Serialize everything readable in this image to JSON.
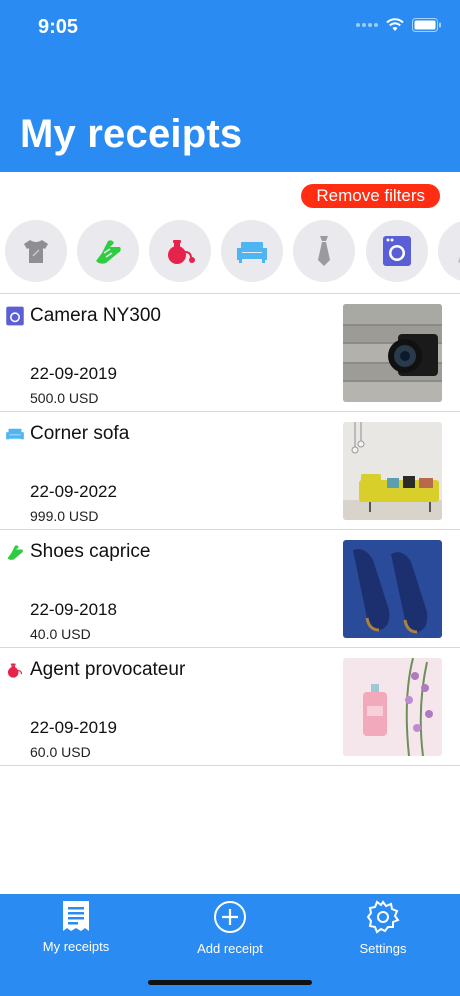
{
  "status_bar": {
    "time": "9:05"
  },
  "header": {
    "title": "My receipts"
  },
  "filters": {
    "remove_label": "Remove filters"
  },
  "categories": [
    {
      "icon": "tshirt-icon",
      "color": "#8e8e93"
    },
    {
      "icon": "sneaker-icon",
      "color": "#2ecc40"
    },
    {
      "icon": "perfume-icon",
      "color": "#e5234b"
    },
    {
      "icon": "sofa-icon",
      "color": "#4fb4f2"
    },
    {
      "icon": "tie-icon",
      "color": "#9a9a9f"
    },
    {
      "icon": "washing-machine-icon",
      "color": "#5b5fd6"
    },
    {
      "icon": "partial-icon",
      "color": "#b0b0b5"
    }
  ],
  "receipts": [
    {
      "title": "Camera NY300",
      "date": "22-09-2019",
      "price": "500.0 USD",
      "icon": "washing-machine-icon"
    },
    {
      "title": "Corner sofa",
      "date": "22-09-2022",
      "price": "999.0 USD",
      "icon": "sofa-icon"
    },
    {
      "title": "Shoes caprice",
      "date": "22-09-2018",
      "price": "40.0 USD",
      "icon": "sneaker-icon"
    },
    {
      "title": "Agent provocateur",
      "date": "22-09-2019",
      "price": "60.0 USD",
      "icon": "perfume-icon"
    }
  ],
  "tabbar": {
    "items": [
      {
        "label": "My receipts",
        "icon": "receipt-icon"
      },
      {
        "label": "Add receipt",
        "icon": "plus-circle-icon"
      },
      {
        "label": "Settings",
        "icon": "gear-icon"
      }
    ]
  },
  "colors": {
    "primary": "#2a8cf2",
    "danger": "#ff2d12"
  }
}
